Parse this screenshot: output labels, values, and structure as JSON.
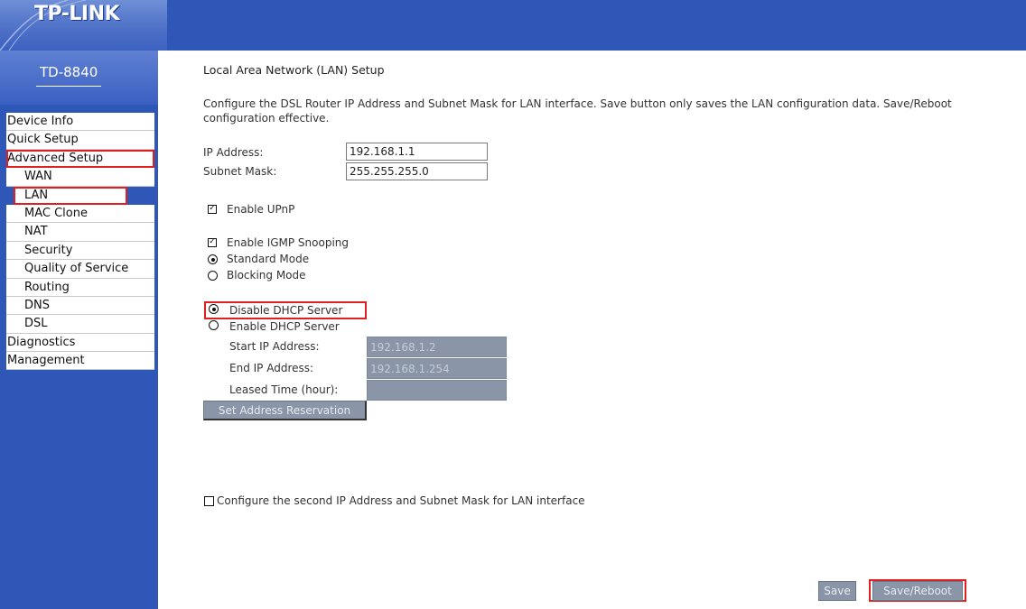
{
  "header": {
    "brand": "TP-LINK",
    "model": "TD-8840"
  },
  "nav": {
    "items": [
      {
        "label": "Device Info"
      },
      {
        "label": "Quick Setup"
      },
      {
        "label": "Advanced Setup"
      },
      {
        "label": "WAN"
      },
      {
        "label": "LAN"
      },
      {
        "label": "MAC Clone"
      },
      {
        "label": "NAT"
      },
      {
        "label": "Security"
      },
      {
        "label": "Quality of Service"
      },
      {
        "label": "Routing"
      },
      {
        "label": "DNS"
      },
      {
        "label": "DSL"
      },
      {
        "label": "Diagnostics"
      },
      {
        "label": "Management"
      }
    ]
  },
  "page": {
    "title": "Local Area Network (LAN) Setup",
    "description_line1": "Configure the DSL Router IP Address and Subnet Mask for LAN interface.  Save button only saves the LAN configuration data.  Save/Reboot",
    "description_line2": "configuration effective."
  },
  "lan": {
    "ip_label": "IP Address:",
    "ip_value": "192.168.1.1",
    "mask_label": "Subnet Mask:",
    "mask_value": "255.255.255.0"
  },
  "options": {
    "upnp_label": "Enable UPnP",
    "upnp_checked": true,
    "igmp_label": "Enable IGMP Snooping",
    "igmp_checked": true,
    "standard_mode_label": "Standard Mode",
    "blocking_mode_label": "Blocking Mode",
    "igmp_mode_selected": "Standard Mode"
  },
  "dhcp": {
    "disable_label": "Disable DHCP Server",
    "enable_label": "Enable DHCP Server",
    "selected": "Disable DHCP Server",
    "start_label": "Start IP Address:",
    "start_value": "192.168.1.2",
    "end_label": "End IP Address:",
    "end_value": "192.168.1.254",
    "lease_label": "Leased Time (hour):",
    "lease_value": "",
    "reservation_button": "Set Address Reservation"
  },
  "second_ip": {
    "label": "Configure the second IP Address and Subnet Mask for LAN interface",
    "checked": false
  },
  "buttons": {
    "save": "Save",
    "save_reboot": "Save/Reboot"
  },
  "colors": {
    "header_blue": "#2e57b8",
    "highlight_red": "#e02020",
    "disabled_gray": "#8a96a8"
  }
}
